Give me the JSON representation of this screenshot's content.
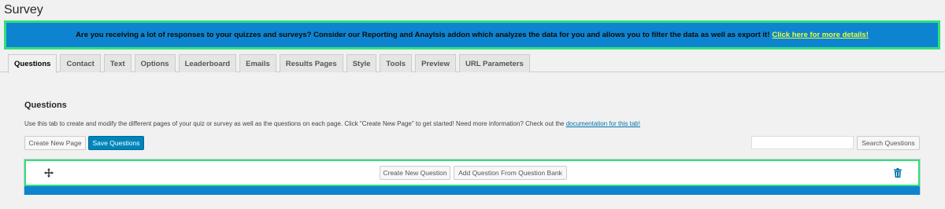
{
  "page": {
    "title": "Survey"
  },
  "banner": {
    "text": "Are you receiving a lot of responses to your quizzes and surveys? Consider our Reporting and Anaylsis addon which analyzes the data for you and allows you to filter the data as well as export it!",
    "link_text": "Click here for more details!"
  },
  "tabs": [
    {
      "label": "Questions",
      "active": true
    },
    {
      "label": "Contact"
    },
    {
      "label": "Text"
    },
    {
      "label": "Options"
    },
    {
      "label": "Leaderboard"
    },
    {
      "label": "Emails"
    },
    {
      "label": "Results Pages"
    },
    {
      "label": "Style"
    },
    {
      "label": "Tools"
    },
    {
      "label": "Preview"
    },
    {
      "label": "URL Parameters"
    }
  ],
  "questions": {
    "title": "Questions",
    "description": "Use this tab to create and modify the different pages of your quiz or survey as well as the questions on each page. Click \"Create New Page\" to get started! Need more information? Check out the",
    "doc_link": "documentation for this tab!",
    "create_page_label": "Create New Page",
    "save_label": "Save Questions",
    "search_placeholder": "",
    "search_button_label": "Search Questions"
  },
  "page_box": {
    "create_question_label": "Create New Question",
    "add_from_bank_label": "Add Question From Question Bank",
    "icons": {
      "move": "move-icon",
      "delete": "trash-icon"
    }
  },
  "colors": {
    "banner_bg": "#0e84d0",
    "highlight_border": "#2ee07a",
    "banner_link": "#e8ff3a",
    "primary_button": "#0085ba"
  }
}
